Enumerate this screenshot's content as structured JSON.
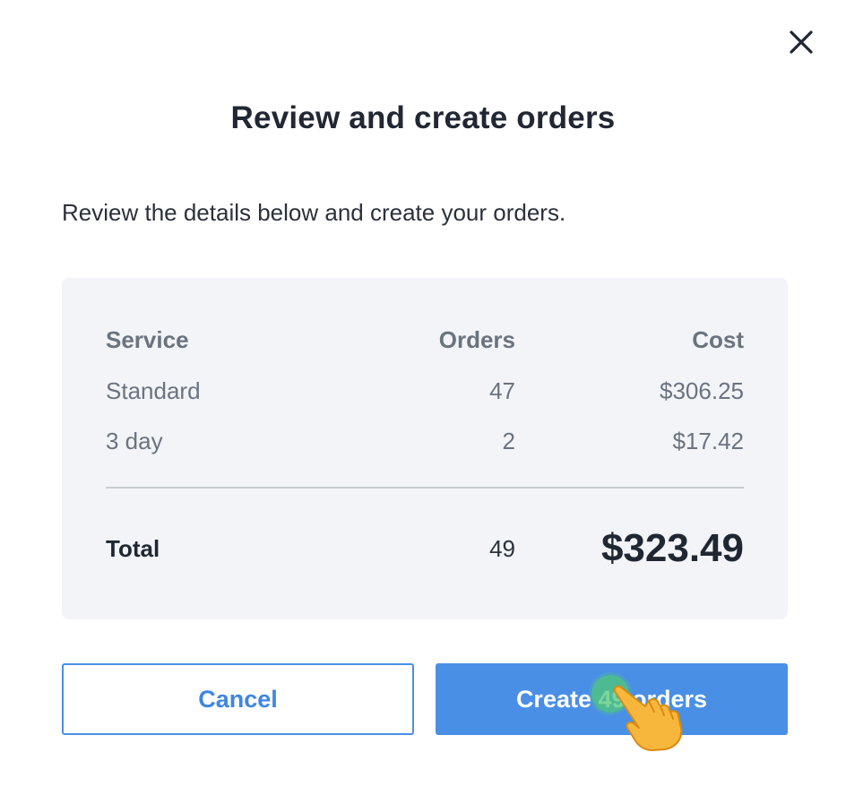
{
  "dialog": {
    "title": "Review and create orders",
    "subtitle": "Review the details below and create your orders."
  },
  "table": {
    "headers": {
      "service": "Service",
      "orders": "Orders",
      "cost": "Cost"
    },
    "rows": [
      {
        "service": "Standard",
        "orders": "47",
        "cost": "$306.25"
      },
      {
        "service": "3 day",
        "orders": "2",
        "cost": "$17.42"
      }
    ],
    "total": {
      "label": "Total",
      "orders": "49",
      "cost": "$323.49"
    }
  },
  "buttons": {
    "cancel_label": "Cancel",
    "create_label": "Create 49 orders"
  },
  "icons": {
    "close": "close-icon",
    "pointer": "pointing-hand-icon"
  },
  "colors": {
    "accent": "#4a8fe6",
    "panel_bg": "#f2f4f7",
    "tap_indicator": "#50c878"
  }
}
